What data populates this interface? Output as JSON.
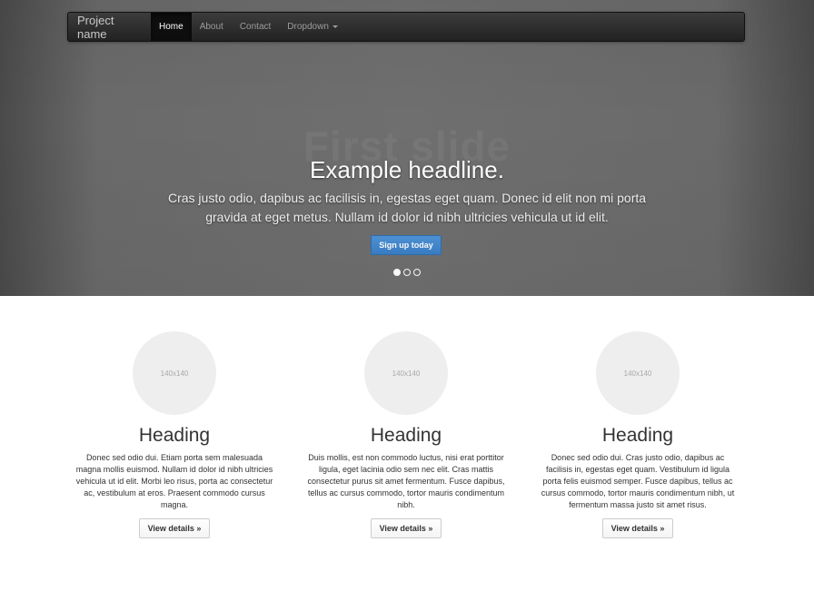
{
  "navbar": {
    "brand": "Project name",
    "items": [
      {
        "label": "Home",
        "active": true
      },
      {
        "label": "About",
        "active": false
      },
      {
        "label": "Contact",
        "active": false
      },
      {
        "label": "Dropdown",
        "active": false,
        "icon": "caret-down-icon"
      }
    ]
  },
  "carousel": {
    "ghost_title": "First slide",
    "headline": "Example headline.",
    "lead": "Cras justo odio, dapibus ac facilisis in, egestas eget quam. Donec id elit non mi porta gravida at eget metus. Nullam id dolor id nibh ultricies vehicula ut id elit.",
    "button_label": "Sign up today",
    "indicators": [
      {
        "active": true
      },
      {
        "active": false
      },
      {
        "active": false
      }
    ],
    "accent": "#428bca"
  },
  "columns": [
    {
      "image_label": "140x140",
      "heading": "Heading",
      "text": "Donec sed odio dui. Etiam porta sem malesuada magna mollis euismod. Nullam id dolor id nibh ultricies vehicula ut id elit. Morbi leo risus, porta ac consectetur ac, vestibulum at eros. Praesent commodo cursus magna.",
      "button_label": "View details »"
    },
    {
      "image_label": "140x140",
      "heading": "Heading",
      "text": "Duis mollis, est non commodo luctus, nisi erat porttitor ligula, eget lacinia odio sem nec elit. Cras mattis consectetur purus sit amet fermentum. Fusce dapibus, tellus ac cursus commodo, tortor mauris condimentum nibh.",
      "button_label": "View details »"
    },
    {
      "image_label": "140x140",
      "heading": "Heading",
      "text": "Donec sed odio dui. Cras justo odio, dapibus ac facilisis in, egestas eget quam. Vestibulum id ligula porta felis euismod semper. Fusce dapibus, tellus ac cursus commodo, tortor mauris condimentum nibh, ut fermentum massa justo sit amet risus.",
      "button_label": "View details »"
    }
  ]
}
